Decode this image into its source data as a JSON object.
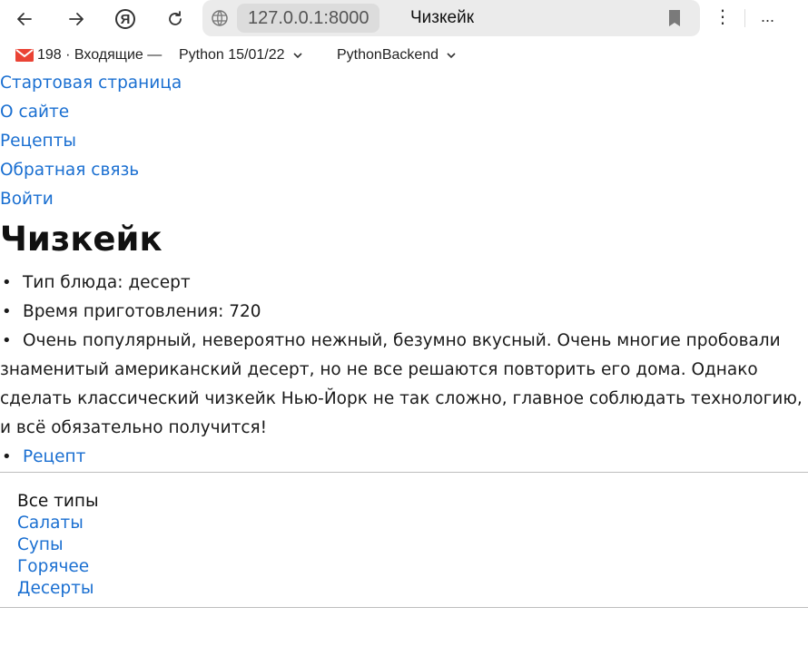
{
  "browser": {
    "url": "127.0.0.1:8000",
    "tab_title": "Чизкейк",
    "yandex_letter": "Я",
    "menu_glyph": "⋮",
    "overflow_glyph": "...",
    "icons": [
      "back-arrow-icon",
      "forward-arrow-icon",
      "yandex-icon",
      "reload-icon",
      "globe-icon",
      "bookmark-icon",
      "menu-icon"
    ]
  },
  "bookmarks": {
    "mail": "198 · Входящие —",
    "folder1": "Python 15/01/22",
    "folder2": "PythonBackend"
  },
  "nav": {
    "home": "Стартовая страница",
    "about": "О сайте",
    "recipes": "Рецепты",
    "feedback": "Обратная связь",
    "login": "Войти"
  },
  "recipe": {
    "title": "Чизкейк",
    "bullet": "•",
    "dish_type": "Тип блюда: десерт",
    "cook_time": "Время приготовления: 720",
    "description": "Очень популярный, невероятно нежный, безумно вкусный. Очень многие пробовали знаменитый американский десерт, но не все решаются повторить его дома. Однако сделать классический чизкейк Нью-Йорк не так сложно, главное соблюдать технологию, и всё обязательно получится!",
    "recipe_link": "Рецепт"
  },
  "types": {
    "all": "Все типы",
    "salads": "Салаты",
    "soups": "Супы",
    "hot": "Горячее",
    "desserts": "Десерты"
  },
  "colors": {
    "link": "#1a6fd1",
    "text": "#1a1a1a",
    "omnibox": "#ebebeb",
    "gmail_red": "#ea4335"
  }
}
